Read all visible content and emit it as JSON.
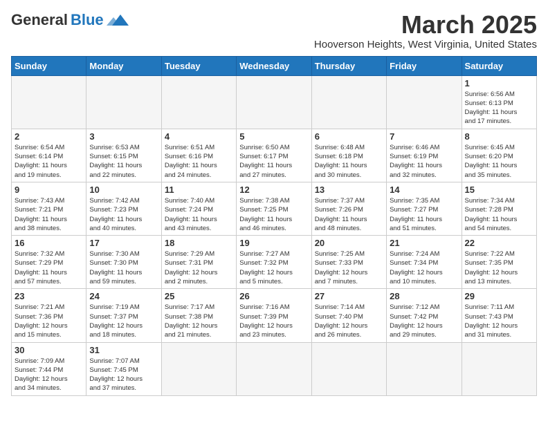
{
  "header": {
    "logo_general": "General",
    "logo_blue": "Blue",
    "title": "March 2025",
    "subtitle": "Hooverson Heights, West Virginia, United States"
  },
  "days_of_week": [
    "Sunday",
    "Monday",
    "Tuesday",
    "Wednesday",
    "Thursday",
    "Friday",
    "Saturday"
  ],
  "weeks": [
    [
      {
        "day": "",
        "info": ""
      },
      {
        "day": "",
        "info": ""
      },
      {
        "day": "",
        "info": ""
      },
      {
        "day": "",
        "info": ""
      },
      {
        "day": "",
        "info": ""
      },
      {
        "day": "",
        "info": ""
      },
      {
        "day": "1",
        "info": "Sunrise: 6:56 AM\nSunset: 6:13 PM\nDaylight: 11 hours\nand 17 minutes."
      }
    ],
    [
      {
        "day": "2",
        "info": "Sunrise: 6:54 AM\nSunset: 6:14 PM\nDaylight: 11 hours\nand 19 minutes."
      },
      {
        "day": "3",
        "info": "Sunrise: 6:53 AM\nSunset: 6:15 PM\nDaylight: 11 hours\nand 22 minutes."
      },
      {
        "day": "4",
        "info": "Sunrise: 6:51 AM\nSunset: 6:16 PM\nDaylight: 11 hours\nand 24 minutes."
      },
      {
        "day": "5",
        "info": "Sunrise: 6:50 AM\nSunset: 6:17 PM\nDaylight: 11 hours\nand 27 minutes."
      },
      {
        "day": "6",
        "info": "Sunrise: 6:48 AM\nSunset: 6:18 PM\nDaylight: 11 hours\nand 30 minutes."
      },
      {
        "day": "7",
        "info": "Sunrise: 6:46 AM\nSunset: 6:19 PM\nDaylight: 11 hours\nand 32 minutes."
      },
      {
        "day": "8",
        "info": "Sunrise: 6:45 AM\nSunset: 6:20 PM\nDaylight: 11 hours\nand 35 minutes."
      }
    ],
    [
      {
        "day": "9",
        "info": "Sunrise: 7:43 AM\nSunset: 7:21 PM\nDaylight: 11 hours\nand 38 minutes."
      },
      {
        "day": "10",
        "info": "Sunrise: 7:42 AM\nSunset: 7:23 PM\nDaylight: 11 hours\nand 40 minutes."
      },
      {
        "day": "11",
        "info": "Sunrise: 7:40 AM\nSunset: 7:24 PM\nDaylight: 11 hours\nand 43 minutes."
      },
      {
        "day": "12",
        "info": "Sunrise: 7:38 AM\nSunset: 7:25 PM\nDaylight: 11 hours\nand 46 minutes."
      },
      {
        "day": "13",
        "info": "Sunrise: 7:37 AM\nSunset: 7:26 PM\nDaylight: 11 hours\nand 48 minutes."
      },
      {
        "day": "14",
        "info": "Sunrise: 7:35 AM\nSunset: 7:27 PM\nDaylight: 11 hours\nand 51 minutes."
      },
      {
        "day": "15",
        "info": "Sunrise: 7:34 AM\nSunset: 7:28 PM\nDaylight: 11 hours\nand 54 minutes."
      }
    ],
    [
      {
        "day": "16",
        "info": "Sunrise: 7:32 AM\nSunset: 7:29 PM\nDaylight: 11 hours\nand 57 minutes."
      },
      {
        "day": "17",
        "info": "Sunrise: 7:30 AM\nSunset: 7:30 PM\nDaylight: 11 hours\nand 59 minutes."
      },
      {
        "day": "18",
        "info": "Sunrise: 7:29 AM\nSunset: 7:31 PM\nDaylight: 12 hours\nand 2 minutes."
      },
      {
        "day": "19",
        "info": "Sunrise: 7:27 AM\nSunset: 7:32 PM\nDaylight: 12 hours\nand 5 minutes."
      },
      {
        "day": "20",
        "info": "Sunrise: 7:25 AM\nSunset: 7:33 PM\nDaylight: 12 hours\nand 7 minutes."
      },
      {
        "day": "21",
        "info": "Sunrise: 7:24 AM\nSunset: 7:34 PM\nDaylight: 12 hours\nand 10 minutes."
      },
      {
        "day": "22",
        "info": "Sunrise: 7:22 AM\nSunset: 7:35 PM\nDaylight: 12 hours\nand 13 minutes."
      }
    ],
    [
      {
        "day": "23",
        "info": "Sunrise: 7:21 AM\nSunset: 7:36 PM\nDaylight: 12 hours\nand 15 minutes."
      },
      {
        "day": "24",
        "info": "Sunrise: 7:19 AM\nSunset: 7:37 PM\nDaylight: 12 hours\nand 18 minutes."
      },
      {
        "day": "25",
        "info": "Sunrise: 7:17 AM\nSunset: 7:38 PM\nDaylight: 12 hours\nand 21 minutes."
      },
      {
        "day": "26",
        "info": "Sunrise: 7:16 AM\nSunset: 7:39 PM\nDaylight: 12 hours\nand 23 minutes."
      },
      {
        "day": "27",
        "info": "Sunrise: 7:14 AM\nSunset: 7:40 PM\nDaylight: 12 hours\nand 26 minutes."
      },
      {
        "day": "28",
        "info": "Sunrise: 7:12 AM\nSunset: 7:42 PM\nDaylight: 12 hours\nand 29 minutes."
      },
      {
        "day": "29",
        "info": "Sunrise: 7:11 AM\nSunset: 7:43 PM\nDaylight: 12 hours\nand 31 minutes."
      }
    ],
    [
      {
        "day": "30",
        "info": "Sunrise: 7:09 AM\nSunset: 7:44 PM\nDaylight: 12 hours\nand 34 minutes."
      },
      {
        "day": "31",
        "info": "Sunrise: 7:07 AM\nSunset: 7:45 PM\nDaylight: 12 hours\nand 37 minutes."
      },
      {
        "day": "",
        "info": ""
      },
      {
        "day": "",
        "info": ""
      },
      {
        "day": "",
        "info": ""
      },
      {
        "day": "",
        "info": ""
      },
      {
        "day": "",
        "info": ""
      }
    ]
  ]
}
